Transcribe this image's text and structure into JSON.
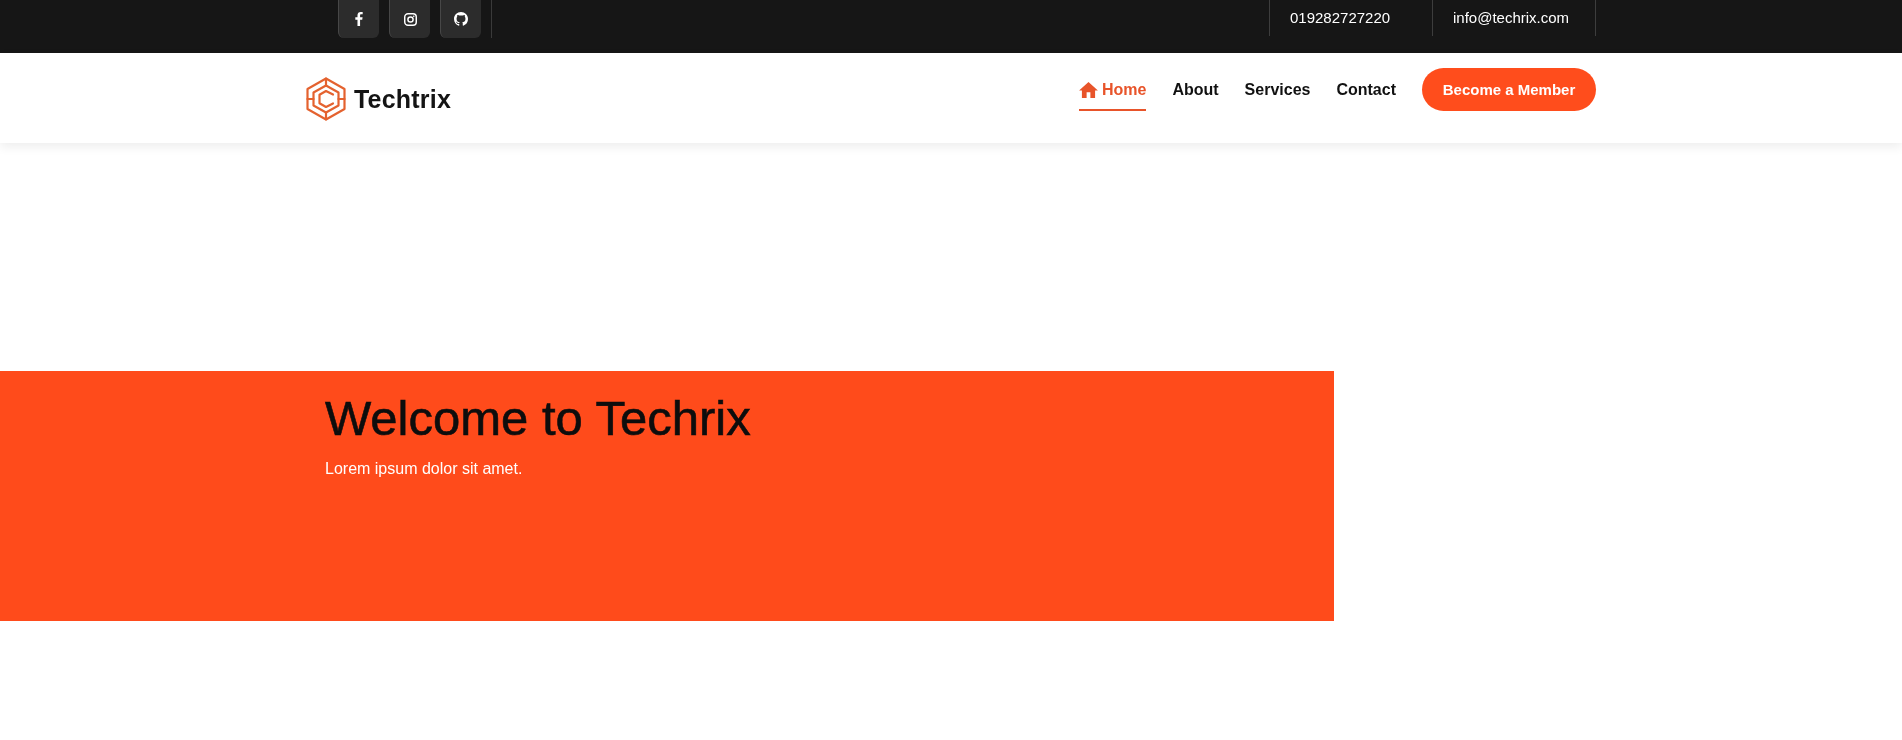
{
  "top_bar": {
    "social_links": [
      {
        "kind": "facebook"
      },
      {
        "kind": "instagram"
      },
      {
        "kind": "github"
      }
    ],
    "phone": "019282727220",
    "email": "info@techrix.com"
  },
  "navbar": {
    "brand": "Techtrix",
    "links": [
      {
        "label": "Home",
        "kind": "icon-link",
        "selected": true
      },
      {
        "label": "About",
        "kind": "text-link",
        "selected": false
      },
      {
        "label": "Services",
        "kind": "text-link",
        "selected": false
      },
      {
        "label": "Contact",
        "kind": "text-link",
        "selected": false
      }
    ],
    "cta_button": "Become a Member"
  },
  "hero": {
    "title": "Welcome to Techrix",
    "subtitle": "Lorem ipsum dolor sit amet."
  }
}
